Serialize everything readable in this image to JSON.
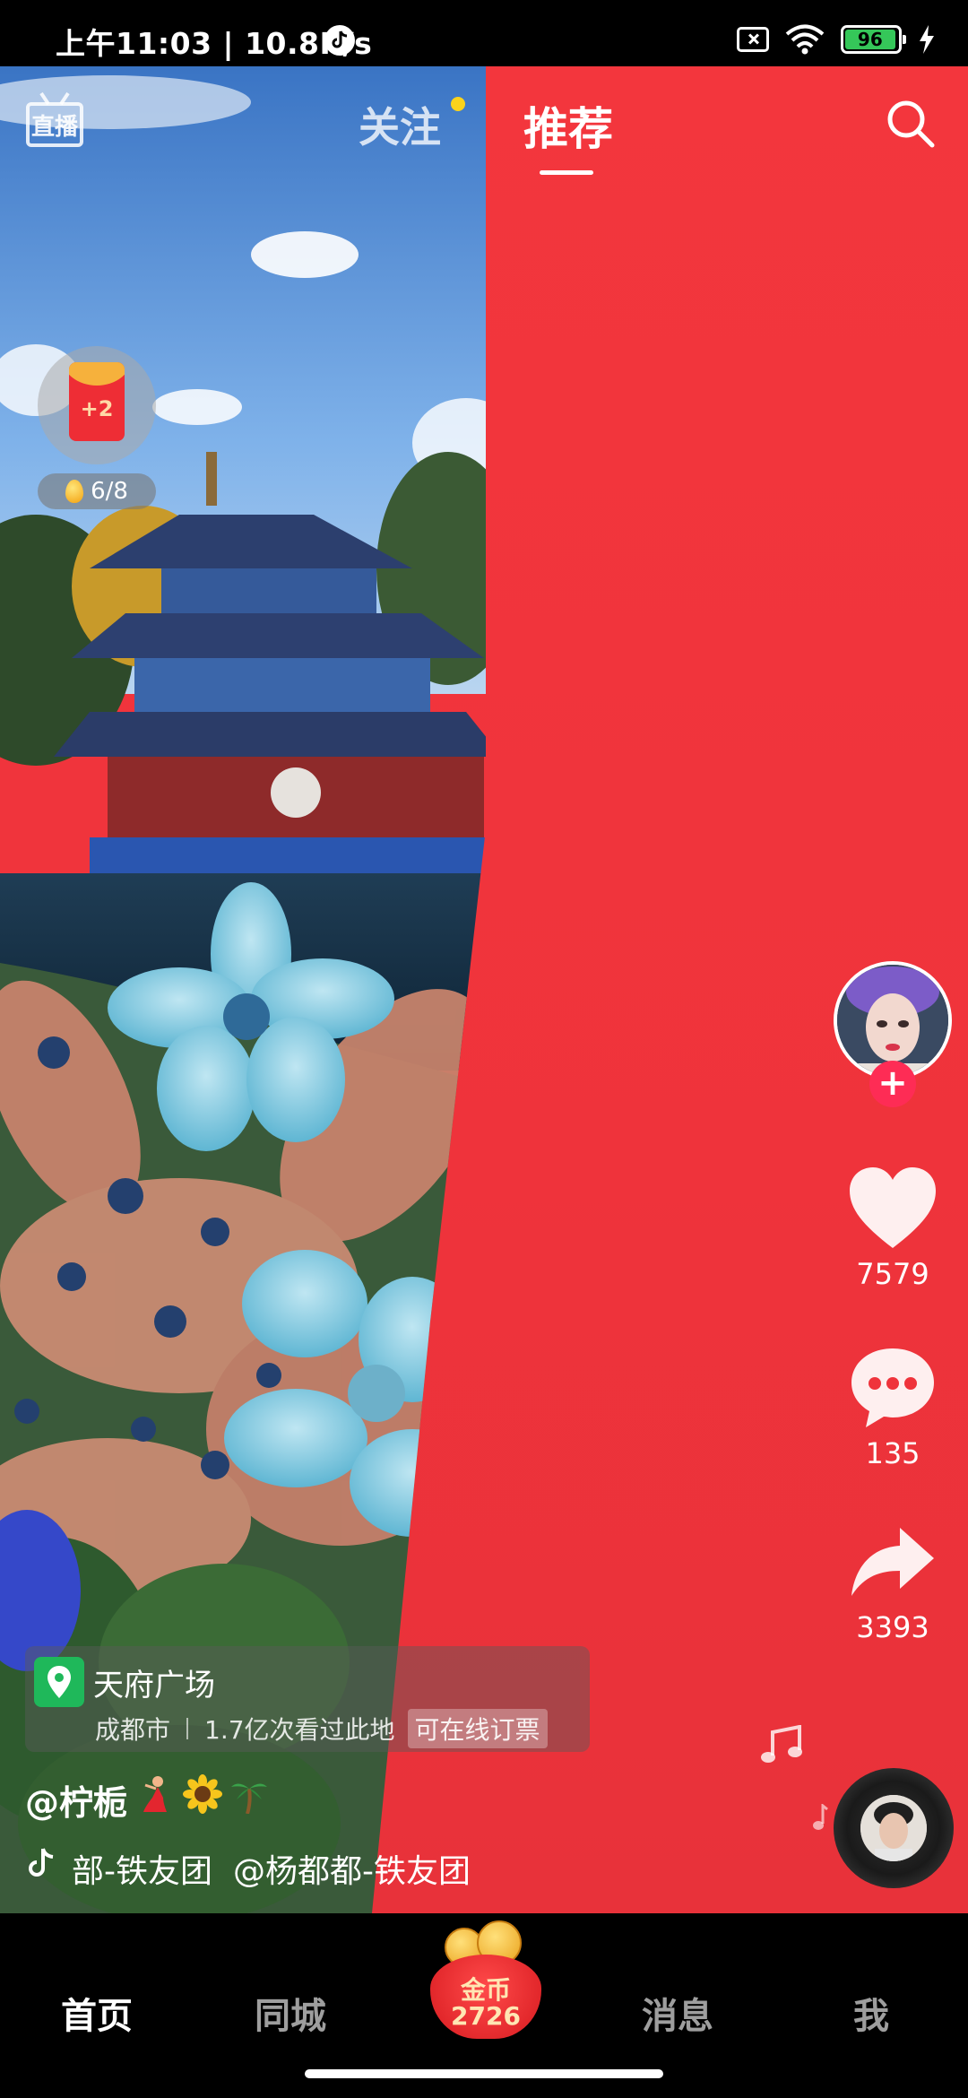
{
  "status_bar": {
    "time_speed": "上午11:03 | 10.8K/s",
    "battery_level": "96",
    "icons": [
      "tiktok-app-icon",
      "sim-disabled-icon",
      "wifi-icon",
      "battery-icon",
      "charging-icon"
    ]
  },
  "top_nav": {
    "live_label": "直播",
    "tab_follow": "关注",
    "tab_recommend": "推荐",
    "active_tab": "推荐",
    "search_icon": "search-icon"
  },
  "red_packet": {
    "bonus": "+2",
    "progress": "6/8"
  },
  "actions": {
    "likes": "7579",
    "comments": "135",
    "shares": "3393"
  },
  "poi": {
    "name": "天府广场",
    "city": "成都市",
    "views": "1.7亿次看过此地",
    "badge": "可在线订票"
  },
  "video": {
    "author": "@柠栀",
    "music_left": "部-铁友团",
    "music_right": "@杨都都-铁友团"
  },
  "bottom_nav": {
    "home": "首页",
    "city": "同城",
    "coin_label": "金币",
    "coin_count": "2726",
    "messages": "消息",
    "me": "我"
  },
  "colors": {
    "background_red": "#f0353d",
    "follow_plus": "#fe2c55",
    "poi_green": "#1fb85a",
    "notification_dot": "#fbd31b"
  }
}
